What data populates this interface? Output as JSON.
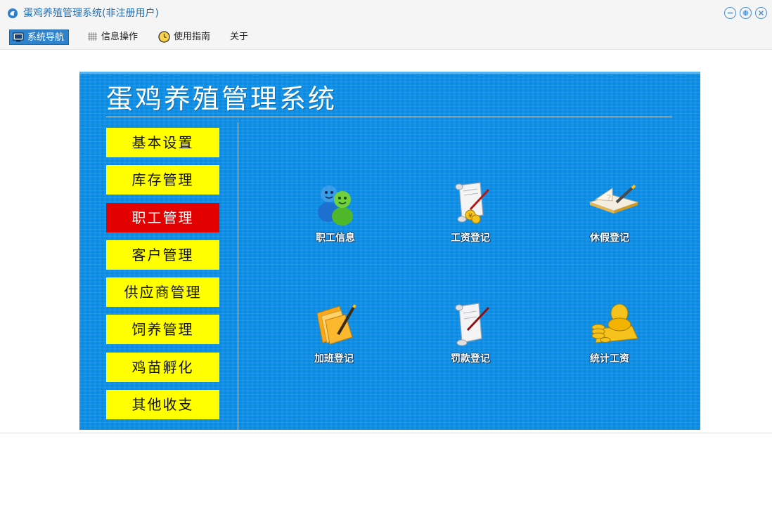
{
  "window": {
    "title": "蛋鸡养殖管理系统(非注册用户)",
    "controls": [
      "minimize-icon",
      "maximize-icon",
      "close-icon"
    ]
  },
  "menubar": {
    "items": [
      {
        "label": "系统导航",
        "icon": "monitor-icon",
        "active": true
      },
      {
        "label": "信息操作",
        "icon": "grid-icon",
        "active": false
      },
      {
        "label": "使用指南",
        "icon": "clock-icon",
        "active": false
      },
      {
        "label": "关于",
        "icon": "",
        "active": false
      }
    ]
  },
  "panel": {
    "title": "蛋鸡养殖管理系统",
    "nav": [
      {
        "label": "基本设置",
        "selected": false
      },
      {
        "label": "库存管理",
        "selected": false
      },
      {
        "label": "职工管理",
        "selected": true
      },
      {
        "label": "客户管理",
        "selected": false
      },
      {
        "label": "供应商管理",
        "selected": false
      },
      {
        "label": "饲养管理",
        "selected": false
      },
      {
        "label": "鸡苗孵化",
        "selected": false
      },
      {
        "label": "其他收支",
        "selected": false
      }
    ],
    "functions": [
      {
        "label": "职工信息",
        "icon": "employees-icon"
      },
      {
        "label": "工资登记",
        "icon": "scroll-money-icon"
      },
      {
        "label": "休假登记",
        "icon": "notebook-pen-icon"
      },
      {
        "label": "加班登记",
        "icon": "folder-pen-icon"
      },
      {
        "label": "罚款登记",
        "icon": "scroll-pen-icon"
      },
      {
        "label": "统计工资",
        "icon": "gold-coins-icon"
      }
    ]
  },
  "colors": {
    "panel_blue": "#0a8ee8",
    "nav_yellow": "#ffff00",
    "nav_selected_red": "#e30000",
    "menu_active_blue": "#2f82cc",
    "title_text_blue": "#1f6fb5"
  }
}
